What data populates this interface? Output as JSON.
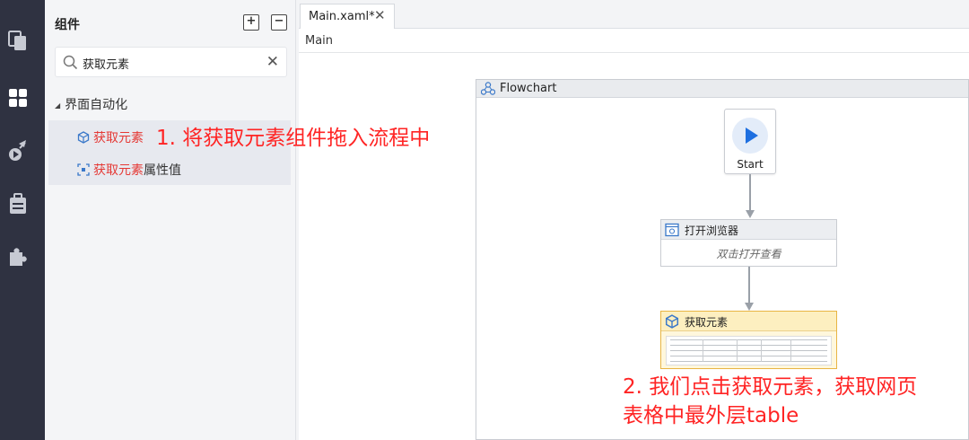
{
  "rail": {
    "icons": [
      "copy-icon",
      "grid-icon",
      "rocket-icon",
      "briefcase-icon",
      "puzzle-icon"
    ]
  },
  "panel": {
    "title": "组件",
    "expand_btn": "+",
    "collapse_btn": "−",
    "search": {
      "value": "获取元素",
      "clear": "✕"
    },
    "category": "界面自动化",
    "items": [
      {
        "highlight": "获取元素",
        "rest": ""
      },
      {
        "highlight": "获取元素",
        "rest": "属性值"
      }
    ]
  },
  "annotations": {
    "step1": "1. 将获取元素组件拖入流程中",
    "step2_line1": "2. 我们点击获取元素，获取网页",
    "step2_line2": "表格中最外层table"
  },
  "editor": {
    "tab": {
      "label": "Main.xaml*",
      "close": "✕"
    },
    "breadcrumb": "Main",
    "flowchart": {
      "title": "Flowchart",
      "start_label": "Start",
      "activities": [
        {
          "title": "打开浏览器",
          "hint": "双击打开查看"
        },
        {
          "title": "获取元素"
        }
      ]
    }
  },
  "colors": {
    "rail_bg": "#2f3241",
    "annotation": "#ff2424",
    "highlight_text": "#e53935",
    "start_play": "#1e6fe0",
    "selected_activity": "#fff7dc"
  }
}
